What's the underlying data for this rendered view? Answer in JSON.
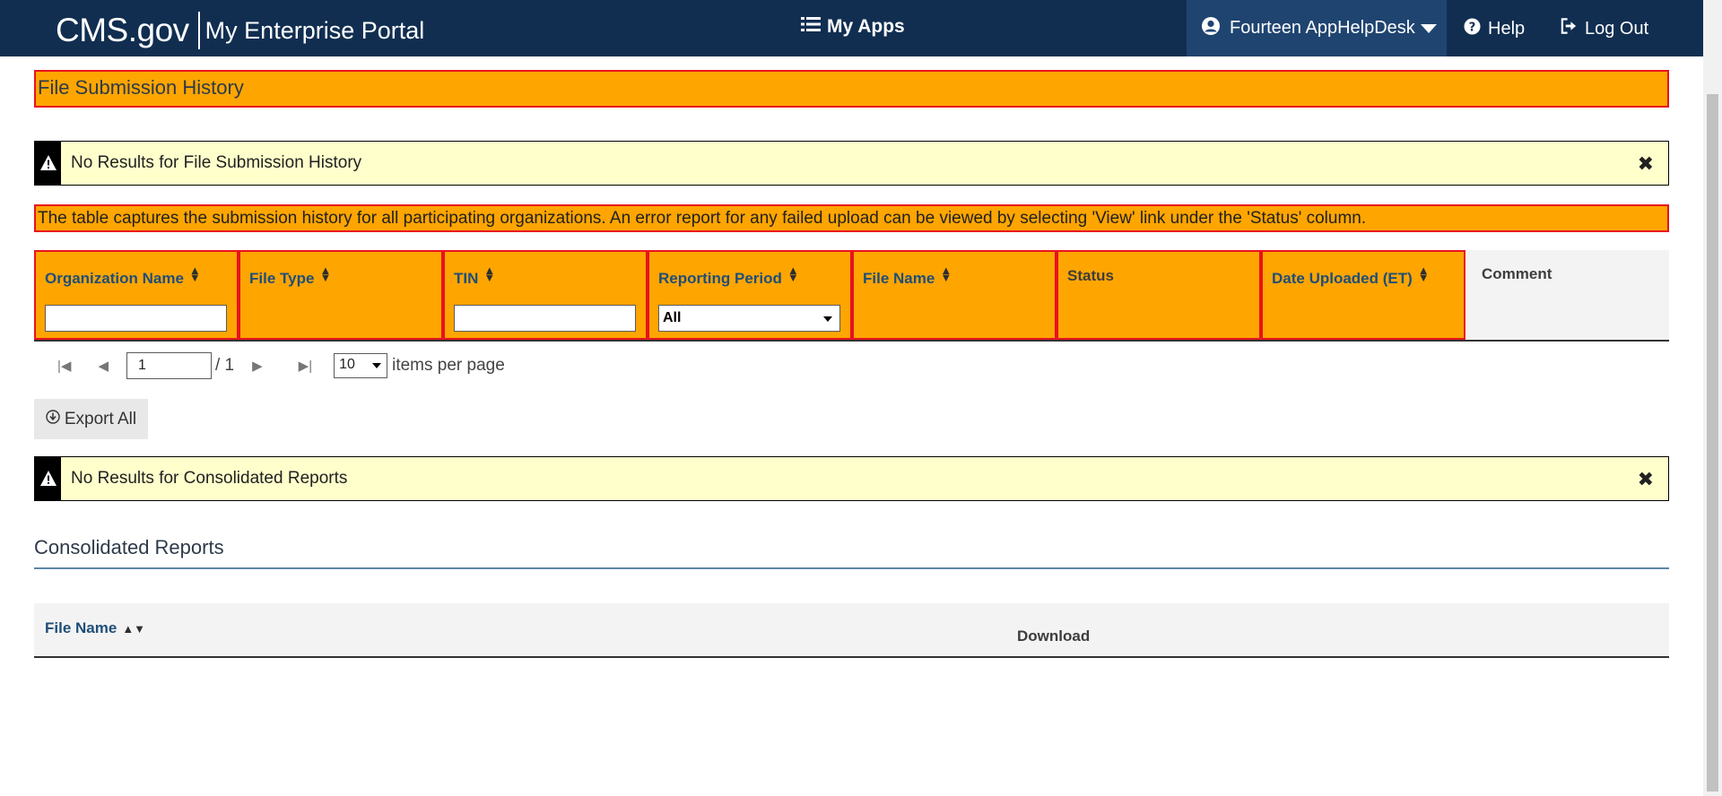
{
  "header": {
    "brand_cms": "CMS",
    "brand_gov": ".gov",
    "brand_portal": "My Enterprise Portal",
    "my_apps": "My Apps",
    "user": "Fourteen AppHelpDesk",
    "help": "Help",
    "logout": "Log Out"
  },
  "page": {
    "title": "File Submission History",
    "no_results_alert": "No Results for File Submission History",
    "info": "The table captures the submission history for all participating organizations. An error report for any failed upload can be viewed by selecting 'View' link under the 'Status' column."
  },
  "table": {
    "columns": {
      "org_name": "Organization Name",
      "file_type": "File Type",
      "tin": "TIN",
      "reporting_period": "Reporting Period",
      "file_name": "File Name",
      "status": "Status",
      "date_uploaded": "Date Uploaded (ET)",
      "comment": "Comment"
    },
    "filters": {
      "org_name": "",
      "tin": "",
      "reporting_period": "All"
    }
  },
  "pager": {
    "current_page": "1",
    "total": "/ 1",
    "page_size": "10",
    "items_per_page": "items per page"
  },
  "export_label": "Export All",
  "consolidated": {
    "alert": "No Results for Consolidated Reports",
    "title": "Consolidated Reports",
    "col_file_name": "File Name",
    "col_download": "Download"
  },
  "colors": {
    "nav_bg": "#112e51",
    "highlight": "#ffa500",
    "highlight_border": "#e8121d",
    "alert_bg": "#ffffcc",
    "link": "#1f4e79"
  }
}
